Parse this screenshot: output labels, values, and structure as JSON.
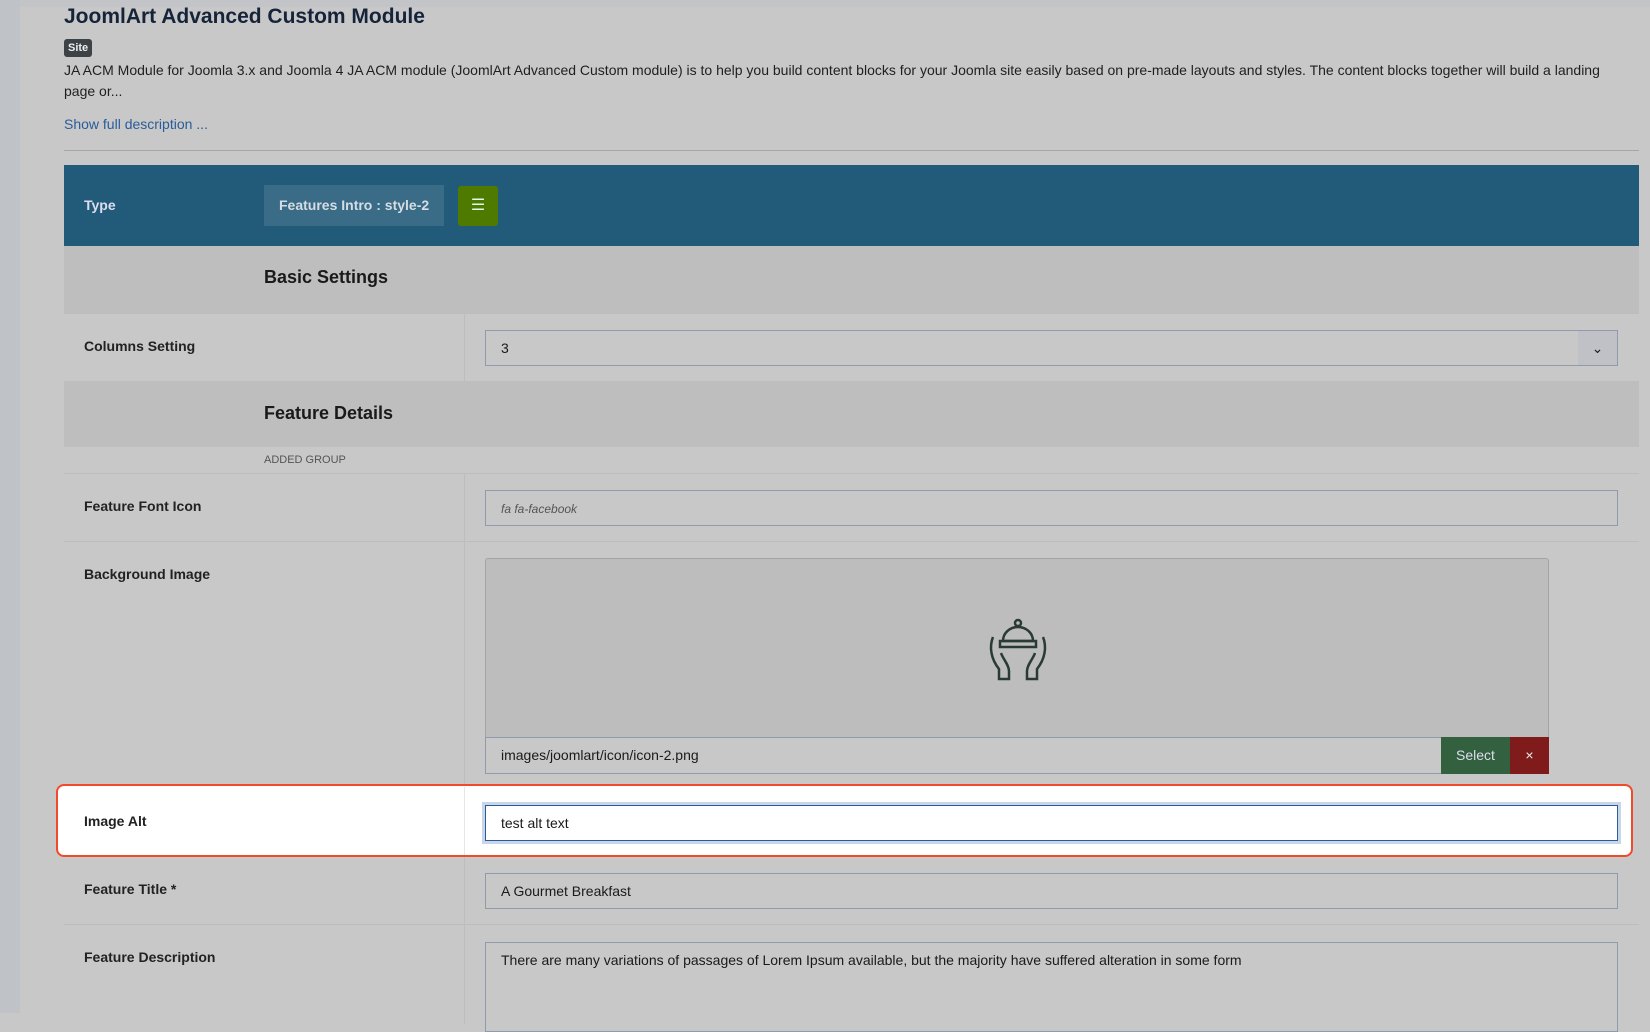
{
  "header": {
    "title": "JoomlArt Advanced Custom Module",
    "badge": "Site",
    "description": "JA ACM Module for Joomla 3.x and Joomla 4 JA ACM module (JoomlArt Advanced Custom module) is to help you build content blocks for your Joomla site easily based on pre-made layouts and styles. The content blocks together will build a landing page or...",
    "show_full": "Show full description ..."
  },
  "type": {
    "label": "Type",
    "value": "Features Intro : style-2",
    "list_icon": "list-icon"
  },
  "sections": {
    "basic": "Basic Settings",
    "details": "Feature Details",
    "added_group": "ADDED GROUP"
  },
  "fields": {
    "columns": {
      "label": "Columns Setting",
      "value": "3"
    },
    "font_icon": {
      "label": "Feature Font Icon",
      "placeholder": "fa fa-facebook"
    },
    "bg_image": {
      "label": "Background Image",
      "path": "images/joomlart/icon/icon-2.png",
      "select": "Select",
      "clear": "×"
    },
    "image_alt": {
      "label": "Image Alt",
      "value": "test alt text"
    },
    "title": {
      "label": "Feature Title *",
      "value": "A Gourmet Breakfast"
    },
    "description": {
      "label": "Feature Description",
      "value": "There are many variations of passages of Lorem Ipsum available, but the majority have suffered alteration in some form"
    }
  },
  "colors": {
    "type_band": "#225a7a",
    "highlight": "#f04a2a",
    "select": "#33603e",
    "clear": "#801b1b"
  }
}
